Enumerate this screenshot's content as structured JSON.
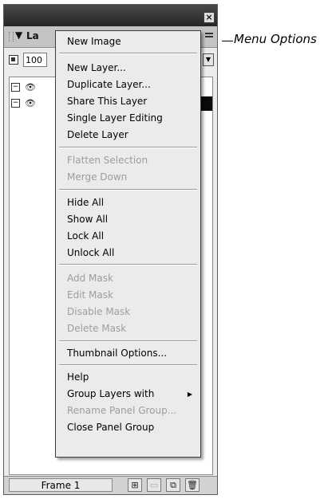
{
  "panel": {
    "close_glyph": "×",
    "tab_label": "La",
    "opacity_value": "100",
    "frame_label": "Frame 1"
  },
  "menu": {
    "items": [
      {
        "label": "New Image",
        "enabled": true
      },
      {
        "label": "New Layer...",
        "enabled": true
      },
      {
        "label": "Duplicate Layer...",
        "enabled": true
      },
      {
        "label": "Share This Layer",
        "enabled": true
      },
      {
        "label": "Single Layer Editing",
        "enabled": true
      },
      {
        "label": "Delete Layer",
        "enabled": true
      },
      {
        "label": "Flatten Selection",
        "enabled": false
      },
      {
        "label": "Merge Down",
        "enabled": false
      },
      {
        "label": "Hide All",
        "enabled": true
      },
      {
        "label": "Show All",
        "enabled": true
      },
      {
        "label": "Lock All",
        "enabled": true
      },
      {
        "label": "Unlock All",
        "enabled": true
      },
      {
        "label": "Add Mask",
        "enabled": false
      },
      {
        "label": "Edit Mask",
        "enabled": false
      },
      {
        "label": "Disable Mask",
        "enabled": false
      },
      {
        "label": "Delete Mask",
        "enabled": false
      },
      {
        "label": "Thumbnail Options...",
        "enabled": true
      },
      {
        "label": "Help",
        "enabled": true
      },
      {
        "label": "Group Layers with",
        "enabled": true,
        "submenu": true
      },
      {
        "label": "Rename Panel Group...",
        "enabled": false
      },
      {
        "label": "Close Panel Group",
        "enabled": true
      }
    ]
  },
  "callout": {
    "text": "Menu Options"
  }
}
